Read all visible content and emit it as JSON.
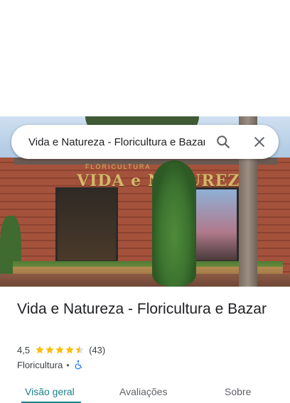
{
  "search": {
    "query": "Vida e Natureza - Floricultura e Bazar"
  },
  "place": {
    "name": "Vida e Natureza - Floricultura e Bazar",
    "rating": "4,5",
    "stars": 4.5,
    "reviews_count": "(43)",
    "category": "Floricultura",
    "separator": "•"
  },
  "tabs": [
    {
      "label": "Visão geral",
      "active": true
    },
    {
      "label": "Avaliações",
      "active": false
    },
    {
      "label": "Sobre",
      "active": false
    }
  ],
  "colors": {
    "accent": "#1a7f8a",
    "star": "#fbbc04",
    "accessibility": "#1a73e8"
  },
  "icons": {
    "search": "search-icon",
    "close": "close-icon",
    "accessibility": "wheelchair-icon"
  }
}
